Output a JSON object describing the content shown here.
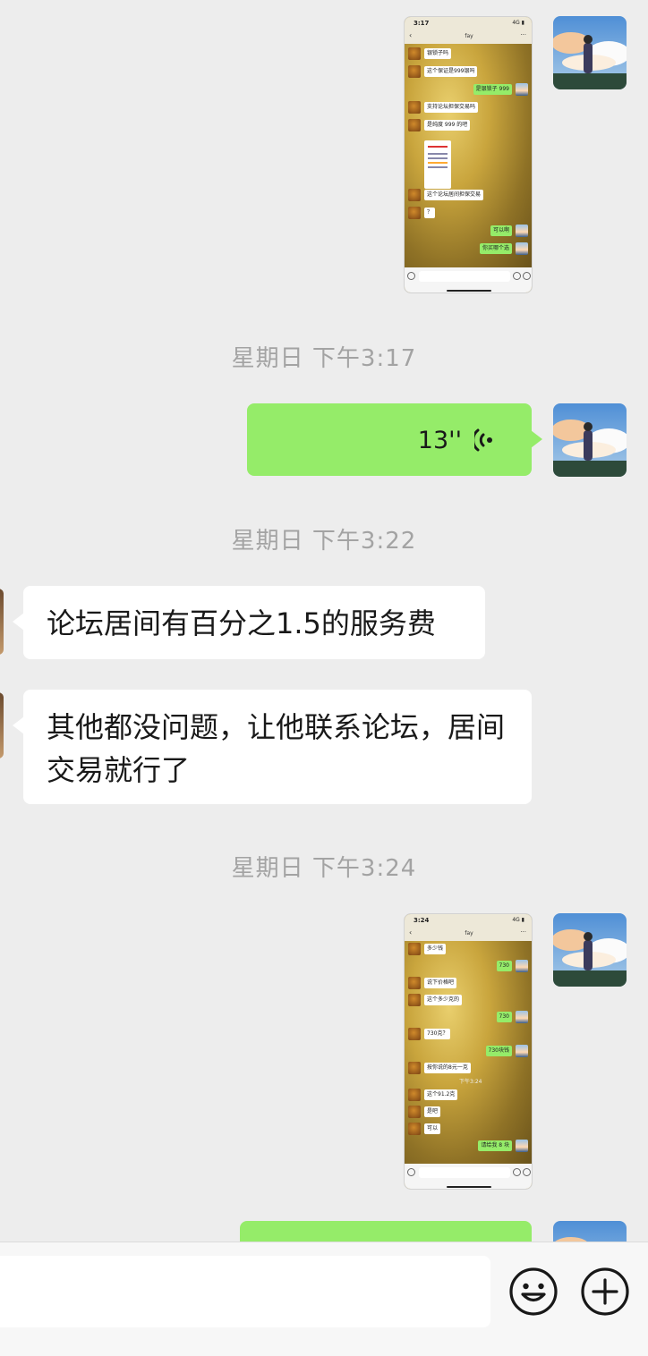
{
  "colors": {
    "background": "#ededed",
    "sent_bubble": "#95ec69",
    "received_bubble": "#ffffff",
    "timestamp_text": "#a3a3a3"
  },
  "messages": {
    "voice_duration": "13''",
    "received_1": "论坛居间有百分之1.5的服务费",
    "received_2": "其他都没问题，让他联系论坛，居间交易就行了"
  },
  "timestamps": {
    "t1": "星期日 下午3:17",
    "t2": "星期日 下午3:22",
    "t3": "星期日 下午3:24"
  },
  "screenshot_1": {
    "time": "3:17",
    "status": "4G ▮",
    "contact": "fay",
    "messages": [
      {
        "side": "l",
        "text": "银锁子吗"
      },
      {
        "side": "l",
        "text": "这个保证是999银吗"
      },
      {
        "side": "r",
        "text": "是银锁子 999"
      },
      {
        "side": "l",
        "text": "支持论坛担保交易吗"
      },
      {
        "side": "l",
        "text": "是纯度 999 的吧"
      },
      {
        "side": "l",
        "text": "这个论坛居间担保交易"
      },
      {
        "side": "l",
        "text": "？"
      },
      {
        "side": "r",
        "text": "可以啊"
      },
      {
        "side": "r",
        "text": "你买哪个选"
      }
    ]
  },
  "screenshot_2": {
    "time": "3:24",
    "status": "4G ▮",
    "contact": "fay",
    "messages": [
      {
        "side": "l",
        "text": "多少钱"
      },
      {
        "side": "r",
        "text": "730"
      },
      {
        "side": "l",
        "text": "说下价格吧"
      },
      {
        "side": "l",
        "text": "这个多少克的"
      },
      {
        "side": "r",
        "text": "730"
      },
      {
        "side": "l",
        "text": "730克？"
      },
      {
        "side": "r",
        "text": "730块钱"
      },
      {
        "side": "l",
        "text": "按你说的8元一克"
      },
      {
        "side": "ts",
        "text": "下午3:24"
      },
      {
        "side": "l",
        "text": "这个91.2克"
      },
      {
        "side": "l",
        "text": "是吧"
      },
      {
        "side": "l",
        "text": "可以"
      },
      {
        "side": "r",
        "text": "请给我 8 块"
      }
    ]
  },
  "input_bar": {
    "emoji_icon": "emoji-icon",
    "plus_icon": "plus-icon"
  }
}
